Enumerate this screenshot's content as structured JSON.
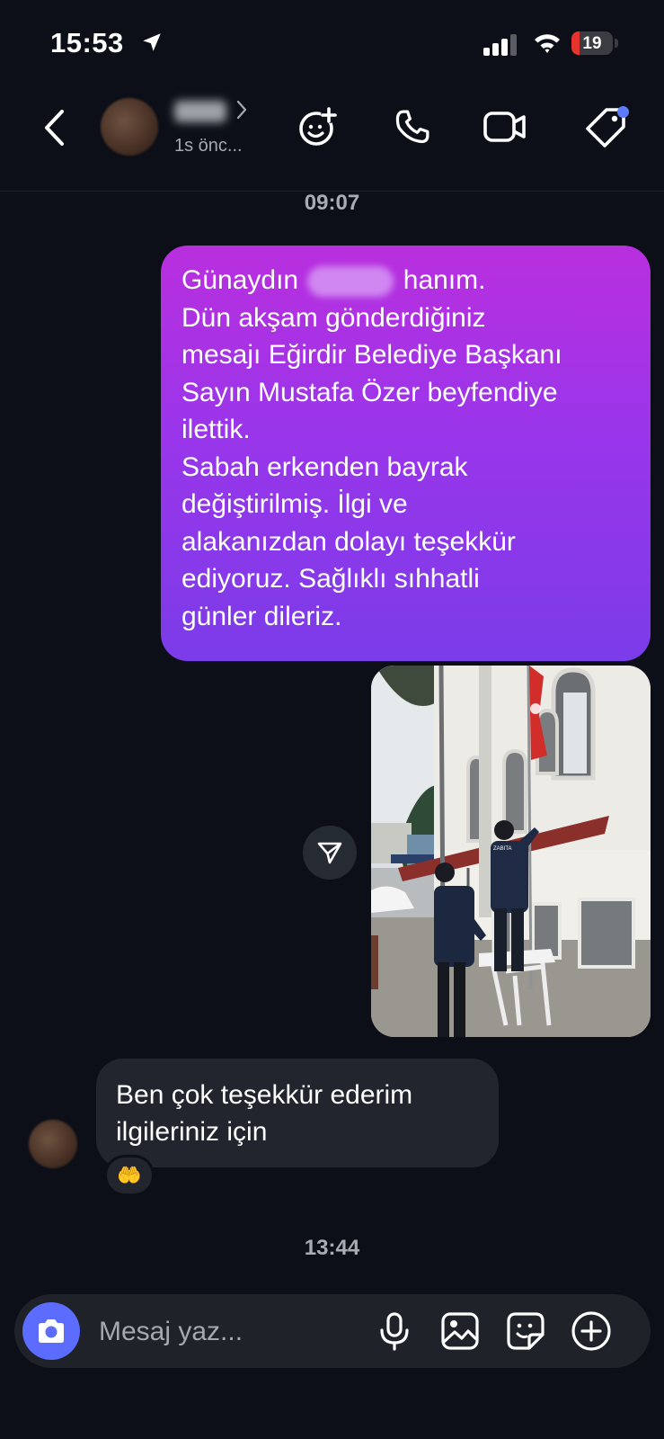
{
  "status_bar": {
    "time": "15:53",
    "battery": "19",
    "battery_level": 0.19
  },
  "header": {
    "contact_status": "1s önc...",
    "accent": "#5b7cff"
  },
  "chat": {
    "timestamp_1": "09:07",
    "outgoing_message": {
      "line1_before": "Günaydın",
      "line1_after": "hanım.",
      "line2": "Dün akşam gönderdiğiniz",
      "line3": "mesajı Eğirdir Belediye Başkanı",
      "line4": "Sayın Mustafa Özer beyfendiye",
      "line5": "ilettik.",
      "line6": "Sabah erkenden bayrak",
      "line7": "değiştirilmiş. İlgi ve",
      "line8": "alakanızdan dolayı teşekkür",
      "line9": "ediyoruz. Sağlıklı sıhhatli",
      "line10": "günler dileriz."
    },
    "photo_vest_text": "ZABITA",
    "incoming_message": {
      "line1": "Ben çok teşekkür ederim",
      "line2": "ilgileriniz için",
      "reaction": "🤲"
    },
    "timestamp_2": "13:44"
  },
  "composer": {
    "placeholder": "Mesaj yaz..."
  },
  "icons": [
    "back-icon",
    "effects-icon",
    "phone-icon",
    "video-icon",
    "tag-icon",
    "share-icon",
    "camera-icon",
    "microphone-icon",
    "gallery-icon",
    "sticker-icon",
    "plus-icon"
  ]
}
